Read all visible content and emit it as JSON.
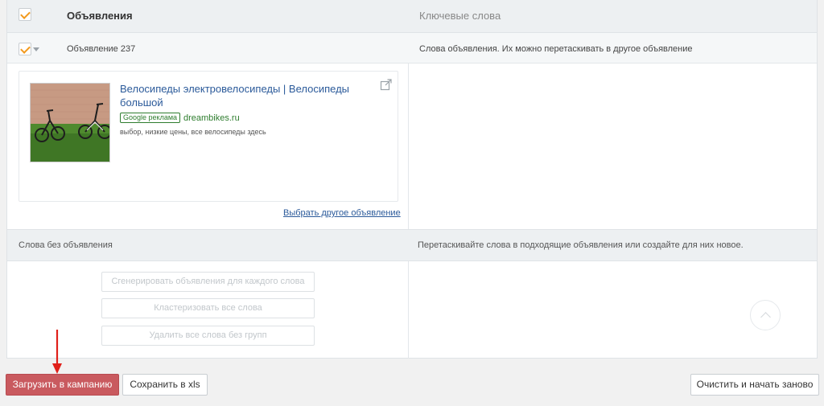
{
  "table": {
    "header": {
      "ads_label": "Объявления",
      "keywords_label": "Ключевые слова"
    },
    "ad_row": {
      "name": "Объявление 237",
      "keywords_hint": "Слова объявления. Их можно перетаскивать в другое объявление"
    },
    "ad_preview": {
      "title": "Велосипеды электровелосипеды | Велосипеды большой",
      "badge": "Google реклама",
      "domain": "dreambikes.ru",
      "description": "выбор, низкие цены, все велосипеды здесь",
      "choose_link": "Выбрать другое объявление"
    },
    "section": {
      "unassigned_label": "Слова без объявления",
      "drag_hint": "Перетаскивайте слова в подходящие объявления или создайте для них новое."
    },
    "actions": {
      "generate": "Сгенерировать объявления для каждого слова",
      "cluster": "Кластеризовать все слова",
      "delete_ungrouped": "Удалить все слова без групп"
    }
  },
  "footer": {
    "upload_button": "Загрузить в кампанию",
    "save_button": "Сохранить в xls",
    "reset_button": "Очистить и начать заново"
  },
  "colors": {
    "primary": "#c95a5f",
    "checkmark": "#f29a1e",
    "link": "#2b5a9a",
    "ad_green": "#2e7d2e",
    "annotation_arrow": "#e0201a"
  },
  "icons": [
    "checkbox-checked",
    "caret-down-icon",
    "external-link-icon",
    "scroll-top-icon",
    "arrow-annotation"
  ]
}
